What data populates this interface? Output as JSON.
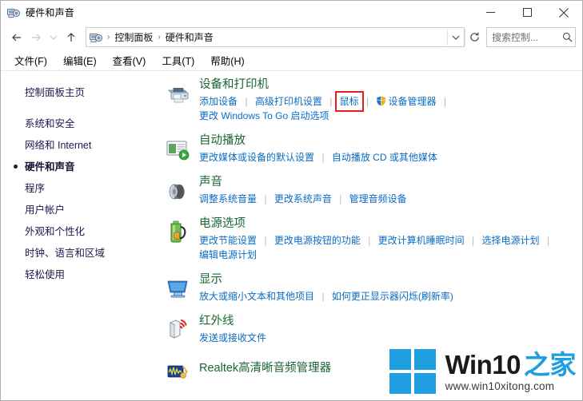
{
  "window": {
    "title": "硬件和声音",
    "icon": "hardware-and-sound-icon",
    "minimize": "—",
    "maximize": "□",
    "close": "✕"
  },
  "nav": {
    "back": "←",
    "forward": "→",
    "recent": "∨",
    "up": "↑",
    "breadcrumbs": [
      "控制面板",
      "硬件和声音"
    ],
    "separator": "›",
    "dropdown": "∨",
    "refresh": "↻"
  },
  "search": {
    "placeholder": "搜索控制...",
    "icon": "search-icon"
  },
  "menubar": {
    "items": [
      {
        "label": "文件(F)"
      },
      {
        "label": "编辑(E)"
      },
      {
        "label": "查看(V)"
      },
      {
        "label": "工具(T)"
      },
      {
        "label": "帮助(H)"
      }
    ]
  },
  "sidebar": {
    "home": "控制面板主页",
    "items": [
      {
        "label": "系统和安全",
        "current": false
      },
      {
        "label": "网络和 Internet",
        "current": false
      },
      {
        "label": "硬件和声音",
        "current": true
      },
      {
        "label": "程序",
        "current": false
      },
      {
        "label": "用户帐户",
        "current": false
      },
      {
        "label": "外观和个性化",
        "current": false
      },
      {
        "label": "时钟、语言和区域",
        "current": false
      },
      {
        "label": "轻松使用",
        "current": false
      }
    ]
  },
  "main": {
    "categories": [
      {
        "title": "设备和打印机",
        "icon": "printer-icon",
        "links_line1": [
          "添加设备",
          "高级打印机设置",
          "鼠标"
        ],
        "highlighted_link": "鼠标",
        "device_manager": "设备管理器",
        "device_manager_icon": "shield-icon",
        "links_line2": [
          "更改 Windows To Go 启动选项"
        ]
      },
      {
        "title": "自动播放",
        "icon": "autoplay-icon",
        "links_line1": [
          "更改媒体或设备的默认设置",
          "自动播放 CD 或其他媒体"
        ],
        "links_line2": []
      },
      {
        "title": "声音",
        "icon": "speaker-icon",
        "links_line1": [
          "调整系统音量",
          "更改系统声音",
          "管理音频设备"
        ],
        "links_line2": []
      },
      {
        "title": "电源选项",
        "icon": "battery-icon",
        "links_line1": [
          "更改节能设置",
          "更改电源按钮的功能",
          "更改计算机睡眠时间",
          "选择电源计划"
        ],
        "links_line2": [
          "编辑电源计划"
        ]
      },
      {
        "title": "显示",
        "icon": "monitor-icon",
        "links_line1": [
          "放大或缩小文本和其他项目",
          "如何更正显示器闪烁(刷新率)"
        ],
        "links_line2": []
      },
      {
        "title": "红外线",
        "icon": "infrared-icon",
        "links_line1": [
          "发送或接收文件"
        ],
        "links_line2": []
      }
    ],
    "standalone": {
      "title": "Realtek高清晰音频管理器",
      "icon": "realtek-audio-icon"
    }
  },
  "watermark": {
    "brand": "Win10",
    "brand_cn": "之家",
    "url": "www.win10xitong.com",
    "logo": "windows-logo"
  },
  "colors": {
    "heading_green": "#1a6633",
    "link_blue": "#0b6cc4",
    "highlight_red": "#ee1c1c",
    "accent_blue": "#1f9ee0"
  }
}
